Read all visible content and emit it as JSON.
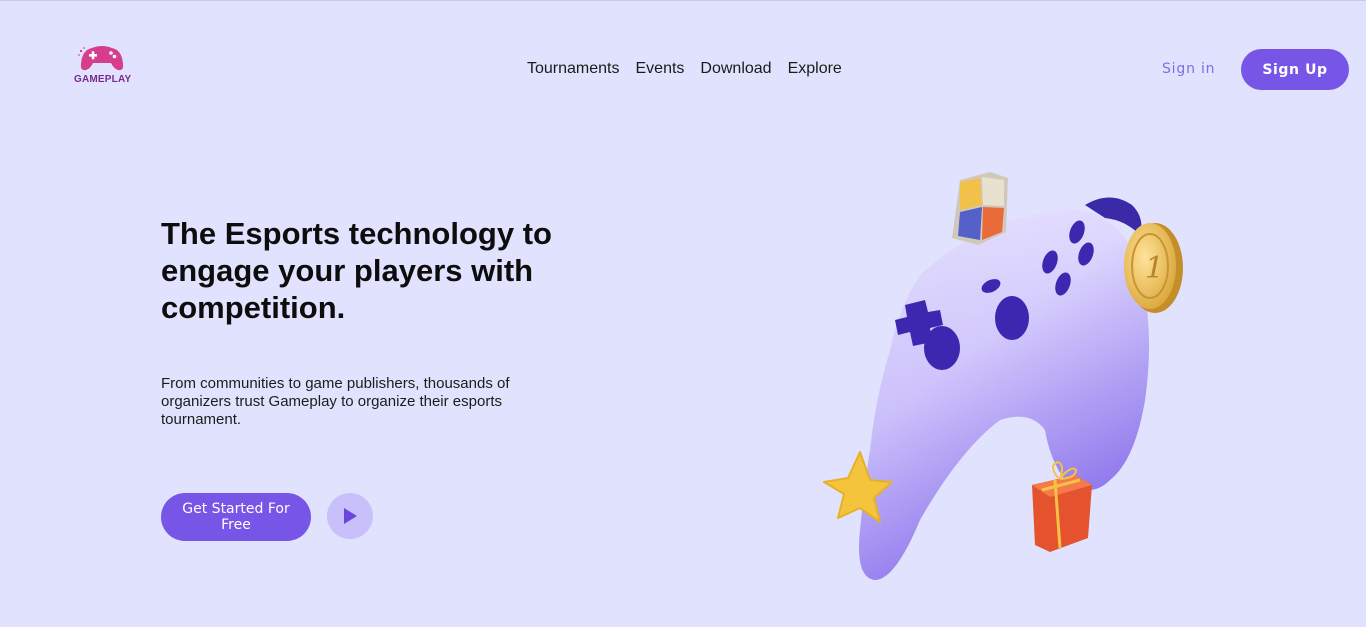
{
  "header": {
    "logo_text": "GAMEPLAY",
    "nav": [
      {
        "label": "Tournaments"
      },
      {
        "label": "Events"
      },
      {
        "label": "Download"
      },
      {
        "label": "Explore"
      }
    ],
    "sign_in": "Sign in",
    "sign_up": "Sign Up"
  },
  "hero": {
    "title": "The Esports technology to engage your players with competition.",
    "description": "From communities to game publishers, thousands of organizers trust Gameplay to organize their esports tournament.",
    "cta_label": "Get Started For Free",
    "play_icon": "play-icon"
  },
  "illustration": {
    "icon": "gamepad-illustration",
    "coin_label": "1"
  },
  "colors": {
    "background": "#e1e3fe",
    "accent": "#7755e7",
    "logo": "#d63d8c",
    "signin": "#7d6fe0"
  }
}
